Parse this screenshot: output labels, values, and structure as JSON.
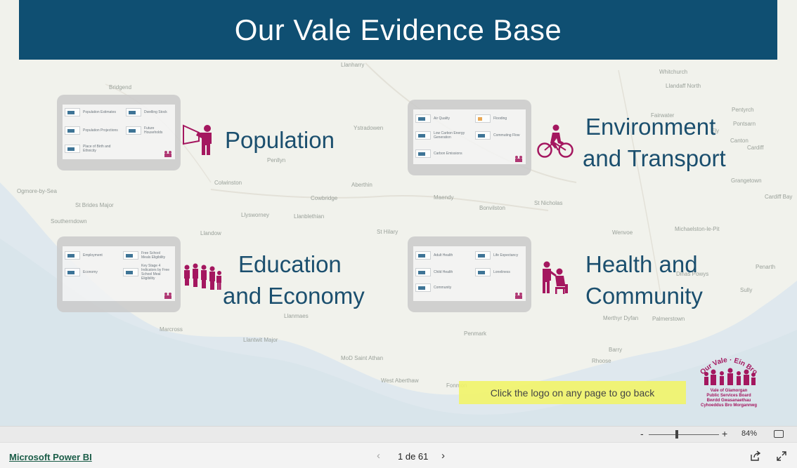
{
  "title": "Our Vale Evidence Base",
  "map_labels": [
    "Bridgend",
    "Llanharry",
    "Cowbridge",
    "Penarth",
    "Barry",
    "Cardiff",
    "Llantwit Major",
    "St Brides Major",
    "Colwinston",
    "Ystradowen",
    "Pentyrch",
    "Whitchurch",
    "Llandaff North",
    "Canton",
    "Sully",
    "Llysworney",
    "Llanmaes",
    "Marcross",
    "Merthyr Dyfan",
    "Wenvoe",
    "Bonvilston",
    "Aberthin",
    "Penllyn",
    "Southerndown",
    "Ogmore-by-Sea",
    "Llanblethian",
    "St Hilary",
    "Penmark",
    "Dinas Powys",
    "Michaelston-le-Pit",
    "MoD Saint Athan",
    "West Aberthaw",
    "Fonmon",
    "Palmerstown",
    "Grangetown",
    "Cardiff Bay",
    "Fairwater",
    "Ely",
    "Llandow",
    "St Nicholas",
    "Maendy",
    "Pontsarn",
    "Rhoose"
  ],
  "thumbnails": {
    "population": [
      "Population Estimates",
      "Dwelling Stock",
      "Population Projections",
      "Future Households",
      "Place of Birth and Ethnicity"
    ],
    "environment": [
      "Air Quality",
      "Flooding",
      "Low Carbon Energy Generation",
      "Commuting Flow",
      "Carbon Emissions"
    ],
    "education": [
      "Employment",
      "Free School Meals Eligibility",
      "Economy",
      "Key Stage 4 Indicators by Free School Meal Eligibility"
    ],
    "health": [
      "Adult Health",
      "Life Expectancy",
      "Child Health",
      "Loneliness",
      "Community"
    ]
  },
  "sections": {
    "population": "Population",
    "environment_line1": "Environment",
    "environment_line2": "and Transport",
    "education_line1": "Education",
    "education_line2": "and Economy",
    "health_line1": "Health and",
    "health_line2": "Community"
  },
  "hint": "Click the logo on any page to go back",
  "logo": {
    "arc_text": "Our Vale · Ein Bro",
    "line1": "Vale of Glamorgan",
    "line2": "Public Services Board",
    "line3": "Bwrdd Gwasanaethau",
    "line4": "Cyhoeddus Bro Morgannwg"
  },
  "zoom": {
    "minus": "-",
    "plus": "+",
    "level": "84%",
    "level_value": 84
  },
  "footer": {
    "link": "Microsoft Power BI",
    "page": "1 de 61",
    "prev": "‹",
    "next": "›"
  },
  "colors": {
    "banner": "#0f4f72",
    "accent": "#a4175f",
    "title_text": "#1b4f6e",
    "hint_bg": "#f2f56a"
  },
  "icons": [
    "presenter-icon",
    "cyclist-icon",
    "classroom-icon",
    "care-icon",
    "share-icon",
    "expand-icon",
    "fit-to-page-icon"
  ]
}
